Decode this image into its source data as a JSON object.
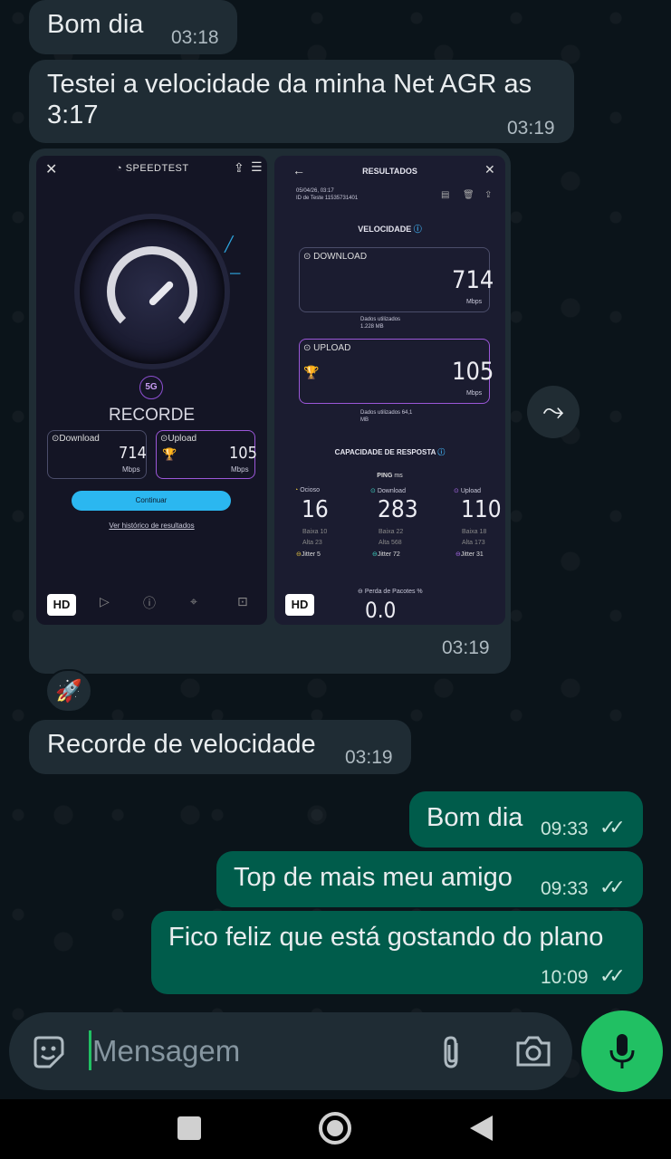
{
  "messages": [
    {
      "text": "Bom dia",
      "time": "03:18"
    },
    {
      "text": "Testei a velocidade da minha Net AGR as 3:17",
      "time": "03:19"
    },
    {
      "image_time": "03:19"
    },
    {
      "reaction": "🚀"
    },
    {
      "text": "Recorde de velocidade",
      "time": "03:19"
    },
    {
      "text": "Bom dia",
      "time": "09:33",
      "status": "read"
    },
    {
      "text": "Top de mais meu amigo",
      "time": "09:33",
      "status": "read"
    },
    {
      "text": "Fico feliz que está gostando do plano",
      "time": "10:09",
      "status": "read"
    }
  ],
  "speedtest_left": {
    "brand": "SPEEDTEST",
    "network_badge": "5G",
    "record_label": "RECORDE",
    "download_label": "Download",
    "download_value": "714",
    "upload_label": "Upload",
    "upload_value": "105",
    "unit": "Mbps",
    "continue_label": "Continuar",
    "history_link": "Ver histórico de resultados",
    "hd": "HD"
  },
  "speedtest_right": {
    "title": "RESULTADOS",
    "date": "05/04/26, 03:17",
    "test_id": "ID de Teste 11535731401",
    "section_speed": "VELOCIDADE",
    "download_label": "DOWNLOAD",
    "download_value": "714",
    "unit": "Mbps",
    "download_data": "Dados utilizados",
    "download_data_value": "1.228 MB",
    "upload_label": "UPLOAD",
    "upload_value": "105",
    "upload_data": "Dados utilizados 64,1",
    "upload_data_unit": "MB",
    "section_response": "CAPACIDADE DE RESPOSTA",
    "ping_label": "PING",
    "ping_unit": "ms",
    "idle_label": "Ocioso",
    "idle_value": "16",
    "idle_low": "Baixa 10",
    "idle_high": "Alta 23",
    "idle_jitter": "Jitter 5",
    "dl_label": "Download",
    "dl_value": "283",
    "dl_low": "Baixa 22",
    "dl_high": "Alta 568",
    "dl_jitter": "Jitter 72",
    "ul_label": "Upload",
    "ul_value": "110",
    "ul_low": "Baixa 18",
    "ul_high": "Alta 173",
    "ul_jitter": "Jitter 31",
    "packet_loss_label": "Perda de Pacotes",
    "packet_loss_unit": "%",
    "packet_loss_value": "0.0",
    "hd": "HD"
  },
  "input": {
    "placeholder": "Mensagem"
  },
  "colors": {
    "incoming": "#1f2c34",
    "outgoing": "#005c4b",
    "accent": "#21c063",
    "background": "#0b141a"
  }
}
